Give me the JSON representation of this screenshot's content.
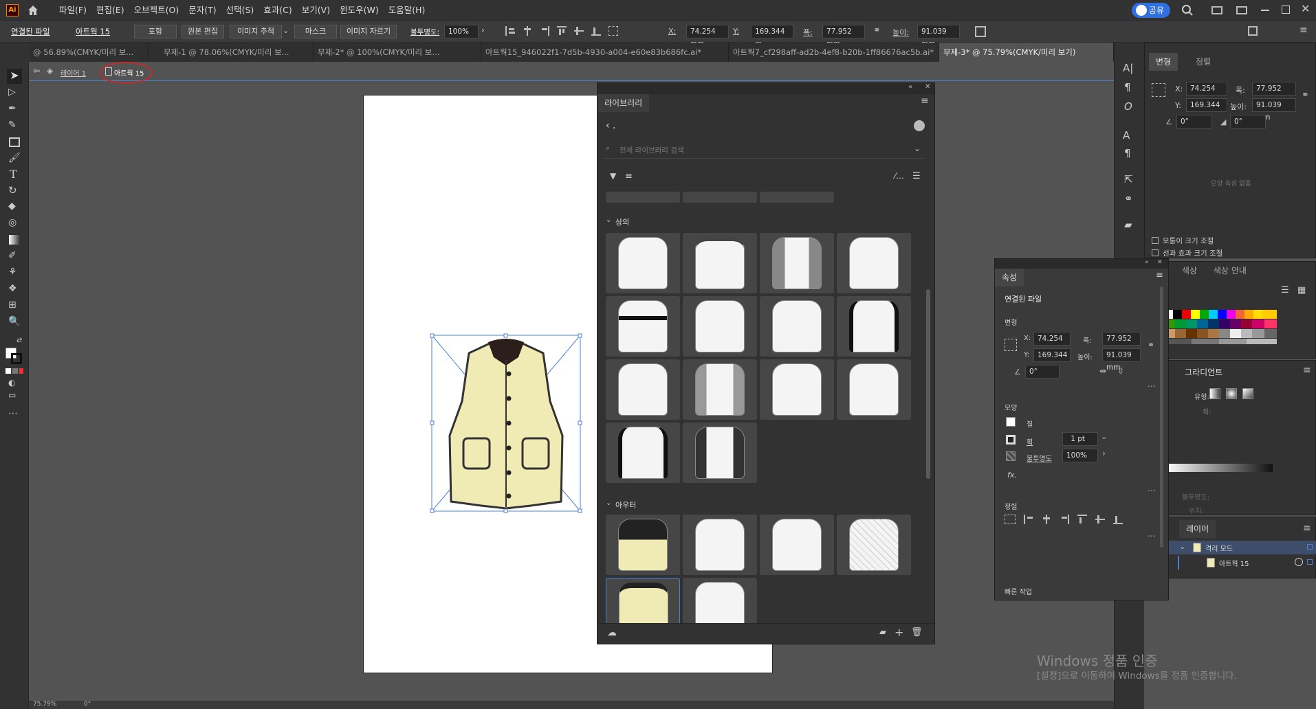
{
  "menubar": {
    "logo": "Ai",
    "items": [
      "파일(F)",
      "편집(E)",
      "오브젝트(O)",
      "문자(T)",
      "선택(S)",
      "효과(C)",
      "보기(V)",
      "윈도우(W)",
      "도움말(H)"
    ],
    "share": "공유"
  },
  "control": {
    "linked_file": "연결된 파일",
    "name": "아트웍 15",
    "embed": "포함",
    "edit_original": "원본 편집",
    "image_trace": "이미지 추적",
    "mask": "마스크",
    "crop": "이미지 자르기",
    "opacity_label": "불투명도:",
    "opacity": "100%",
    "x_label": "X:",
    "x": "74.254 mm",
    "y_label": "Y:",
    "y": "169.344 m",
    "w_label": "폭:",
    "w": "77.952 mm",
    "h_label": "높이:",
    "h": "91.039 mm"
  },
  "tabs": [
    "@ 56.89%(CMYK/미리 보...",
    "무제-1 @ 78.06%(CMYK/미리 보...",
    "무제-2* @ 100%(CMYK/미리 보...",
    "아트웍15_946022f1-7d5b-4930-a004-e60e83b686fc.ai*",
    "아트웍7_cf298aff-ad2b-4ef8-b20b-1ff86676ac5b.ai*",
    "무제-3* @ 75.79%(CMYK/미리 보기)"
  ],
  "breadcrumb": {
    "layer": "레이어 1",
    "item": "아트웍 15"
  },
  "library": {
    "title": "라이브러리",
    "back": "‹ .",
    "search_placeholder": "전체 라이브러리 검색",
    "section_tops": "상의",
    "section_outer": "아우터"
  },
  "transform_panel": {
    "tab1": "변형",
    "tab2": "정렬",
    "x_label": "X:",
    "x": "74.254 mm",
    "y_label": "Y:",
    "y": "169.344 mm",
    "w_label": "폭:",
    "w": "77.952 mm",
    "h_label": "높이:",
    "h": "91.039 mm",
    "angle": "0°",
    "shear": "0°",
    "no_shape": "모양 속성 없음",
    "scale_corners": "모퉁이 크기 조절",
    "scale_strokes": "선과 효과 크기 조절"
  },
  "color_panel": {
    "tab1": "색상",
    "tab2": "색상 안내"
  },
  "gradient_panel": {
    "title": "그라디언트",
    "type_label": "유형:",
    "stroke_label": "획:",
    "opacity_label": "불투명도:",
    "position_label": "위치:"
  },
  "layers_panel": {
    "title": "레이어",
    "layer1": "격리 모드",
    "layer2": "아트웍 15"
  },
  "properties": {
    "title": "속성",
    "section": "연결된 파일",
    "transform": "변형",
    "x_label": "X:",
    "x": "74.254 mm",
    "y_label": "Y:",
    "y": "169.344 m",
    "w_label": "폭:",
    "w": "77.952 mm",
    "h_label": "높이:",
    "h": "91.039 mm",
    "angle": "0°",
    "appearance": "모양",
    "fill": "칠",
    "stroke": "획",
    "stroke_value": "1 pt",
    "opacity": "불투명도",
    "opacity_value": "100%",
    "fx": "fx.",
    "align": "정렬",
    "quick": "빠른 작업"
  },
  "status": {
    "zoom": "75.79%",
    "angle": "0°"
  },
  "watermark": {
    "line1": "Windows 정품 인증",
    "line2": "[설정]으로 이동하여 Windows를 정품 인증합니다."
  },
  "colors": {
    "accent": "#4a7fd4",
    "vest_fill": "#f0ebb4",
    "share": "#2f6fe0"
  }
}
